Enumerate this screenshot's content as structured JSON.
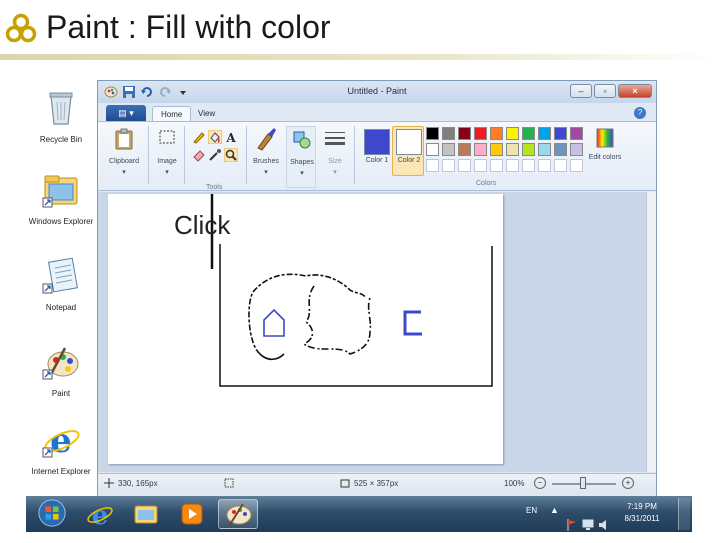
{
  "slide": {
    "title": "Paint : Fill with color",
    "accent_color": "#c8a000",
    "annotation": "Click"
  },
  "desktop": {
    "icons": [
      {
        "name": "recycle-bin-icon",
        "label": "Recycle Bin"
      },
      {
        "name": "windows-explorer-icon",
        "label": "Windows Explorer"
      },
      {
        "name": "notepad-icon",
        "label": "Notepad"
      },
      {
        "name": "paint-icon",
        "label": "Paint"
      },
      {
        "name": "internet-explorer-icon",
        "label": "Internet Explorer"
      }
    ]
  },
  "paint": {
    "window_title": "Untitled - Paint",
    "tabs": {
      "app_menu": "▤ ▾",
      "home": "Home",
      "view": "View"
    },
    "ribbon": {
      "clipboard": "Clipboard",
      "image": "Image",
      "tools_group": "Tools",
      "brushes": "Brushes",
      "shapes": "Shapes",
      "size": "Size",
      "color1": "Color 1",
      "color2": "Color 2",
      "colors_group": "Colors",
      "edit_colors": "Edit colors"
    },
    "palette_row1": [
      "#000000",
      "#7f7f7f",
      "#880015",
      "#ed1c24",
      "#ff7f27",
      "#fff200",
      "#22b14c",
      "#00a2e8",
      "#3f48cc",
      "#a349a4"
    ],
    "palette_row2": [
      "#ffffff",
      "#c3c3c3",
      "#b97a57",
      "#ffaec9",
      "#ffc90e",
      "#efe4b0",
      "#b5e61d",
      "#99d9ea",
      "#7092be",
      "#c8bfe7"
    ],
    "color1_value": "#3f48cc",
    "color2_value": "#ffffff",
    "status": {
      "cursor_pos": "330, 165px",
      "canvas_size": "525 × 357px",
      "zoom": "100%"
    }
  },
  "taskbar": {
    "language": "EN",
    "time": "7:19 PM",
    "date": "8/31/2011",
    "pinned": [
      "start-orb",
      "internet-explorer",
      "windows-explorer",
      "media-player",
      "paint"
    ]
  }
}
